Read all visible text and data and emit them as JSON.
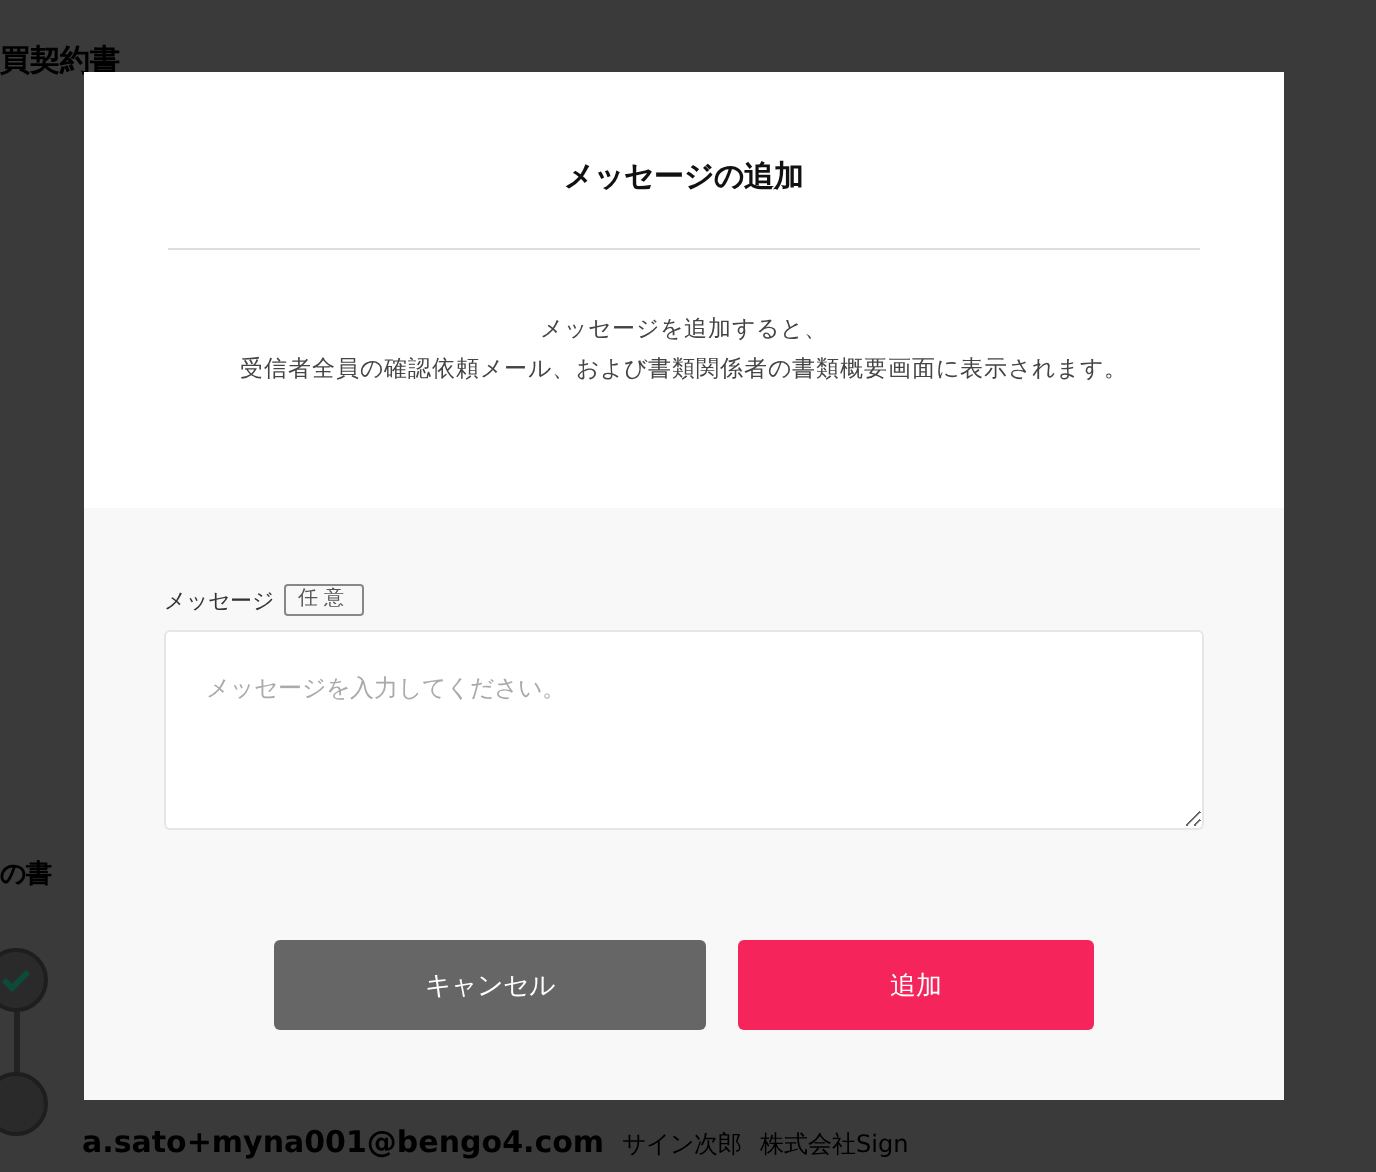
{
  "background": {
    "page_title": "買契約書",
    "section_heading": "の書",
    "steps": [
      {
        "done": true
      },
      {
        "done": false
      }
    ],
    "signer": {
      "email": "a.sato+myna001@bengo4.com",
      "name": "サイン次郎",
      "company": "株式会社Sign"
    }
  },
  "dialog": {
    "title": "メッセージの追加",
    "description": [
      "メッセージを追加すると、",
      "受信者全員の確認依頼メール、および書類関係者の書類概要画面に表示されます。"
    ],
    "field": {
      "label": "メッセージ",
      "badge": "任意",
      "placeholder": "メッセージを入力してください。"
    },
    "buttons": [
      {
        "kind": "secondary",
        "label": "キャンセル"
      },
      {
        "kind": "primary",
        "label": "追加"
      }
    ]
  }
}
